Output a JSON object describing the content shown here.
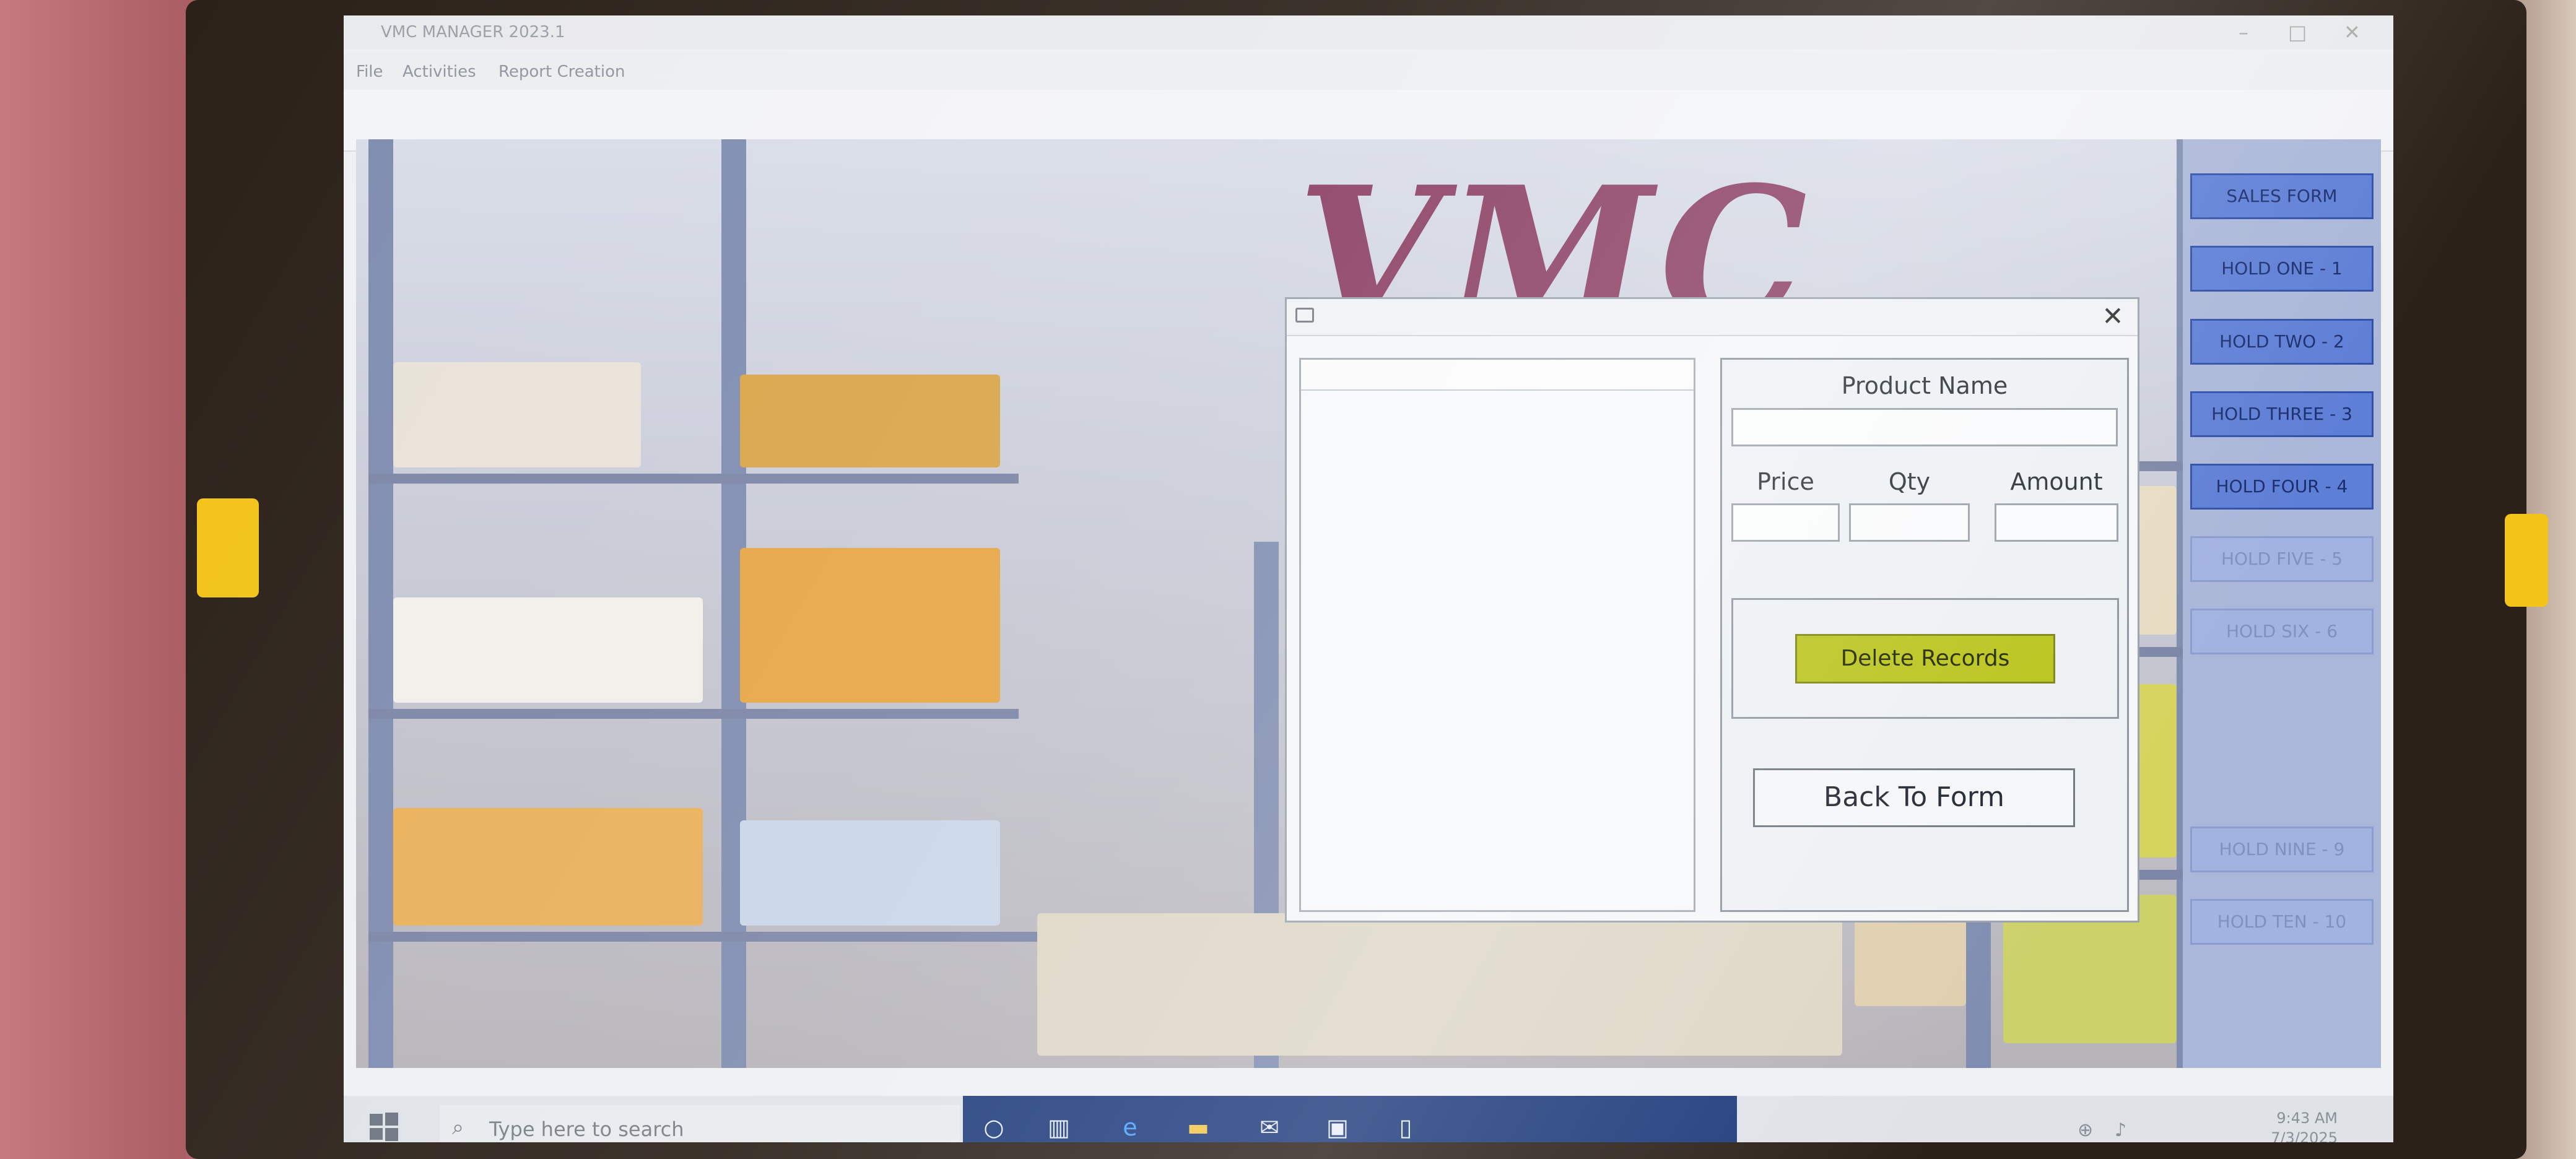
{
  "window": {
    "title": "VMC MANAGER 2023.1",
    "controls": [
      "–",
      "□",
      "✕"
    ]
  },
  "menu": [
    "File",
    "Activities",
    "Report Creation"
  ],
  "background": {
    "logo_text": "VMC"
  },
  "hold_buttons": [
    {
      "label": "SALES FORM",
      "faded": false
    },
    {
      "label": "HOLD ONE - 1",
      "faded": false
    },
    {
      "label": "HOLD TWO - 2",
      "faded": false
    },
    {
      "label": "HOLD THREE - 3",
      "faded": false
    },
    {
      "label": "HOLD FOUR - 4",
      "faded": false
    },
    {
      "label": "HOLD FIVE - 5",
      "faded": true
    },
    {
      "label": "HOLD SIX - 6",
      "faded": true
    },
    {
      "label": "HOLD NINE - 9",
      "faded": true
    },
    {
      "label": "HOLD TEN - 10",
      "faded": true
    }
  ],
  "dialog": {
    "close_glyph": "✕",
    "product_name_label": "Product Name",
    "product_name_value": "",
    "price_label": "Price",
    "price_value": "",
    "qty_label": "Qty",
    "qty_value": "",
    "amount_label": "Amount",
    "amount_value": "",
    "delete_button": "Delete Records",
    "back_button": "Back To Form"
  },
  "taskbar": {
    "search_placeholder": "Type here to search",
    "time": "9:43 AM",
    "date": "7/3/2025",
    "icons": [
      "cortana-icon",
      "task-view-icon",
      "edge-icon",
      "file-explorer-icon",
      "mail-icon",
      "store-icon",
      "app-icon"
    ]
  },
  "colors": {
    "hold_button": "#5e7fd6",
    "delete_button": "#b9c41a",
    "logo": "#8b4063",
    "taskbar_apps": "#1f3c7c"
  }
}
